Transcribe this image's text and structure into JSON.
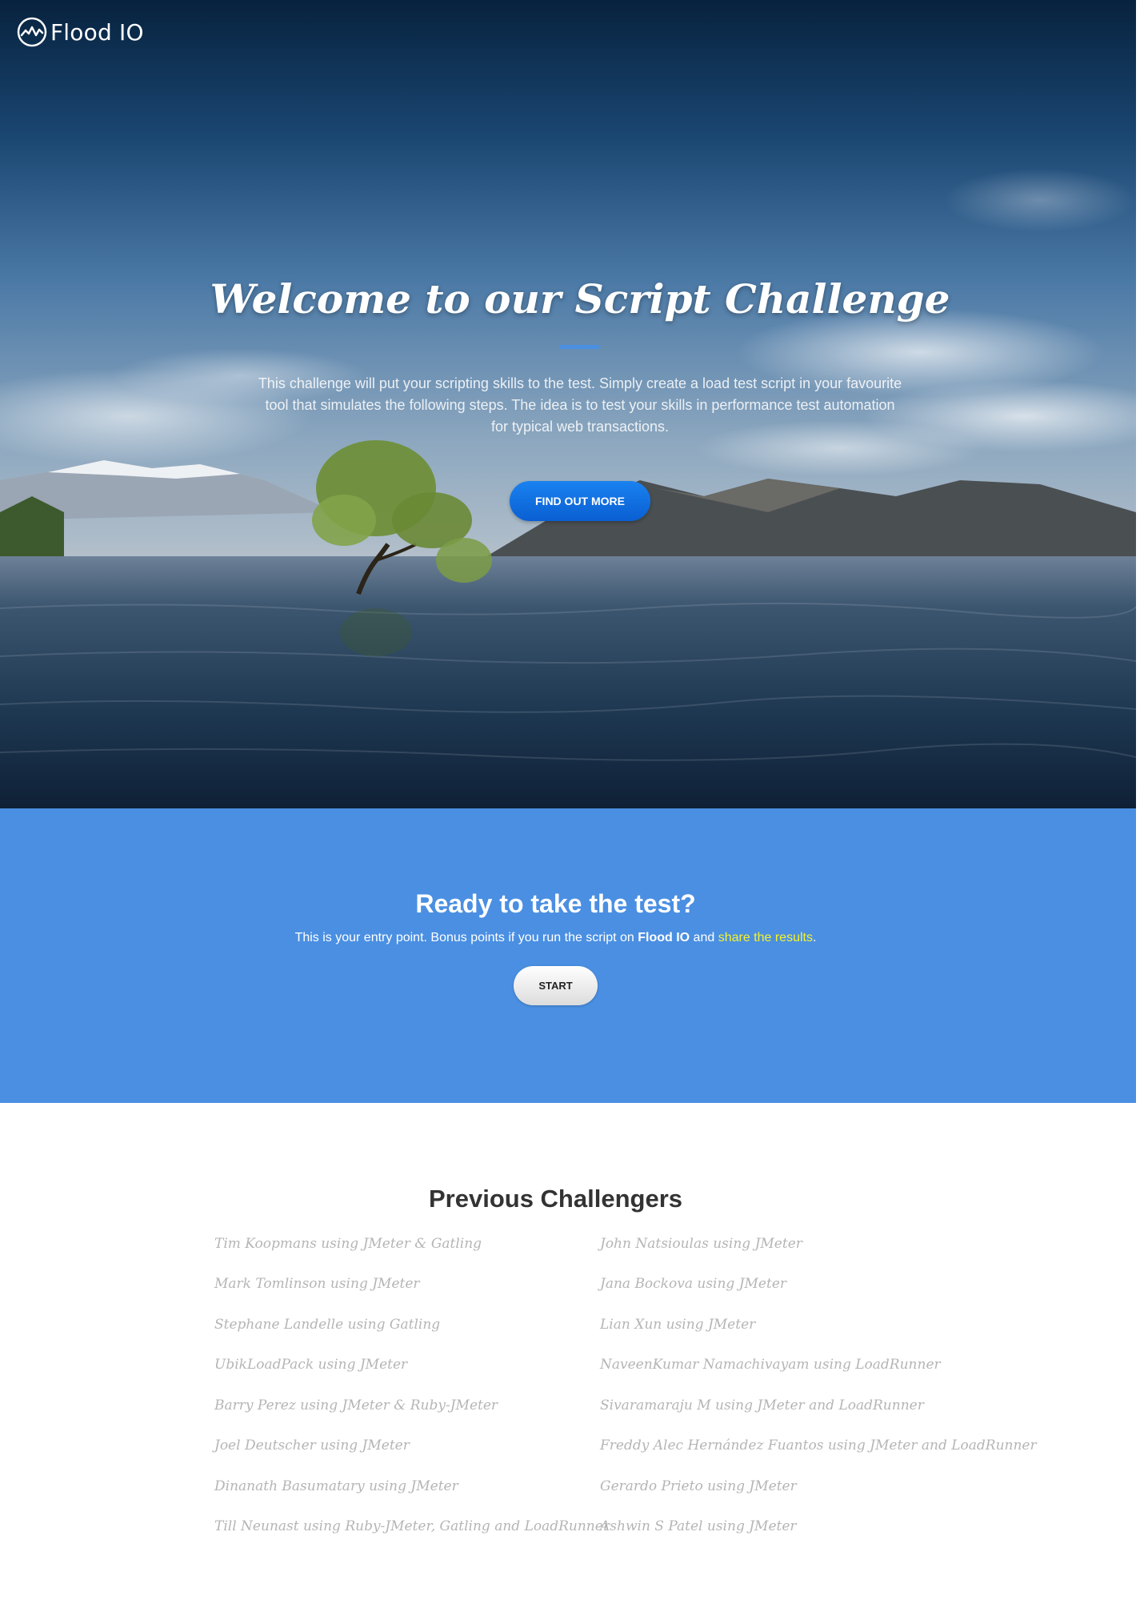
{
  "header": {
    "logo_text": "Flood IO",
    "logo_icon": "flood-logo-icon"
  },
  "hero": {
    "title": "Welcome to our Script Challenge",
    "description": "This challenge will put your scripting skills to the test. Simply create a load test script in your favourite tool that simulates the following steps. The idea is to test your skills in performance test automation for typical web transactions.",
    "button_label": "FIND OUT MORE"
  },
  "cta": {
    "title": "Ready to take the test?",
    "text_before": "This is your entry point. Bonus points if you run the script on ",
    "brand": "Flood IO",
    "text_and": " and ",
    "share_link": "share the results",
    "text_after": ".",
    "start_label": "START"
  },
  "challengers": {
    "title": "Previous Challengers",
    "left": [
      "Tim Koopmans using JMeter & Gatling",
      "Mark Tomlinson using JMeter",
      "Stephane Landelle using Gatling",
      "UbikLoadPack using JMeter",
      "Barry Perez using JMeter & Ruby-JMeter",
      "Joel Deutscher using JMeter",
      "Dinanath Basumatary using JMeter",
      "Till Neunast using Ruby-JMeter, Gatling and LoadRunner"
    ],
    "right": [
      "John Natsioulas using JMeter",
      "Jana Bockova using JMeter",
      "Lian Xun using JMeter",
      "NaveenKumar Namachivayam using LoadRunner",
      "Sivaramaraju M using JMeter and LoadRunner",
      "Freddy Alec Hernández Fuantos using JMeter and LoadRunner",
      "Gerardo Prieto using JMeter",
      "Ashwin S Patel using JMeter"
    ]
  },
  "colors": {
    "accent_blue": "#4a8fe2",
    "button_blue": "#0a66d8",
    "share_yellow": "#f6f32a",
    "challenger_gray": "#b5b5b5"
  }
}
